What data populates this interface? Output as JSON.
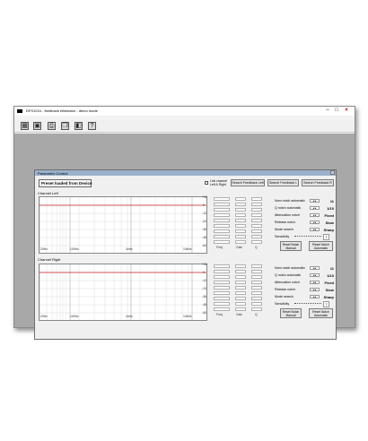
{
  "window": {
    "title": "DFS1224 - feedback eliminator - demo mode"
  },
  "toolbar": {
    "tools": [
      "app-grid-icon",
      "save-icon",
      "print-icon",
      "copy-icon",
      "device-icon",
      "help-icon"
    ]
  },
  "dialog": {
    "title": "Parametric Control",
    "preset_status": "Preset loaded from Device",
    "link_label": "Link channel\nLeft & Right",
    "search_left": "Search Feedback Left",
    "search_left_short": "Search Feedback L",
    "search_right": "Search Feedback R"
  },
  "channels": [
    {
      "label": "Channel Left",
      "freq_ticks": [
        "20Hz",
        "100Hz",
        "1kHz",
        "10kHz"
      ],
      "db_ticks": [
        "+12",
        "0",
        "-12",
        "-24",
        "-36",
        "-48",
        "-60"
      ],
      "columns": [
        "Freq",
        "Gain",
        "Q"
      ],
      "params": [
        {
          "label": "Num notch automatic",
          "value": "11"
        },
        {
          "label": "Q notch automatic",
          "value": "1/10"
        },
        {
          "label": "Attenuation notch",
          "value": "Fixed"
        },
        {
          "label": "Release notch",
          "value": "Slow"
        },
        {
          "label": "Mode search",
          "value": "Sharp"
        },
        {
          "label": "Sensitivity",
          "value": "7"
        }
      ],
      "reset_manual": "Reset Notch\nManual",
      "reset_auto": "Reset Notch\nAutomatic"
    },
    {
      "label": "Channel Right",
      "freq_ticks": [
        "20Hz",
        "100Hz",
        "1kHz",
        "10kHz"
      ],
      "db_ticks": [
        "+12",
        "0",
        "-12",
        "-24",
        "-36",
        "-48",
        "-60"
      ],
      "columns": [
        "Freq",
        "Gain",
        "Q"
      ],
      "params": [
        {
          "label": "Num notch automatic",
          "value": "11"
        },
        {
          "label": "Q notch automatic",
          "value": "1/10"
        },
        {
          "label": "Attenuation notch",
          "value": "Fixed"
        },
        {
          "label": "Release notch",
          "value": "Slow"
        },
        {
          "label": "Mode search",
          "value": "Sharp"
        },
        {
          "label": "Sensitivity",
          "value": "7"
        }
      ],
      "reset_manual": "Reset Notch\nManual",
      "reset_auto": "Reset Notch\nAutomatic"
    }
  ],
  "colors": {
    "accent": "#c82020",
    "titlebar": "#9ab2cc",
    "workspace": "#a8a8a8"
  }
}
